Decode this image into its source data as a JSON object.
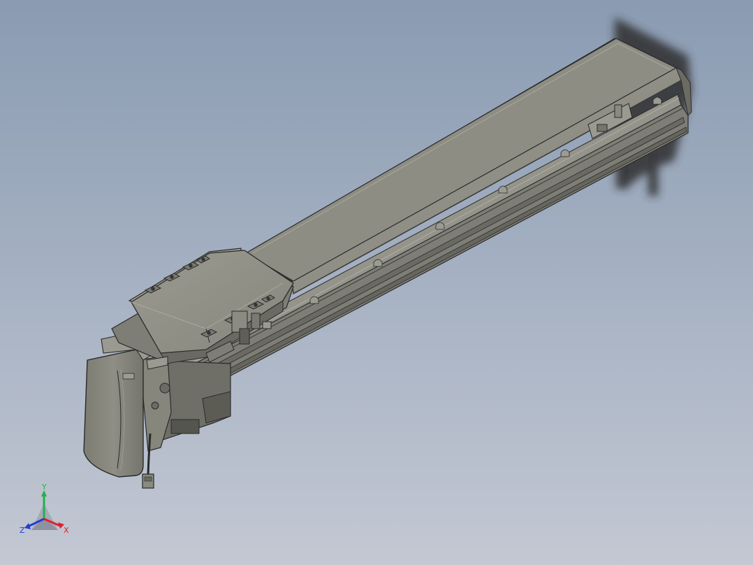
{
  "viewport": {
    "background_top": "#8a9bb2",
    "background_bottom": "#c3c8d3"
  },
  "model": {
    "body_color": "#8f8f86",
    "edge_color": "#2a2a2a",
    "highlight_color": "#a5a59b",
    "shadow_color": "#5e5e58"
  },
  "triad": {
    "x_label": "X",
    "y_label": "Y",
    "z_label": "Z",
    "x_color": "#e0202a",
    "y_color": "#22b14c",
    "z_color": "#2040d0"
  }
}
